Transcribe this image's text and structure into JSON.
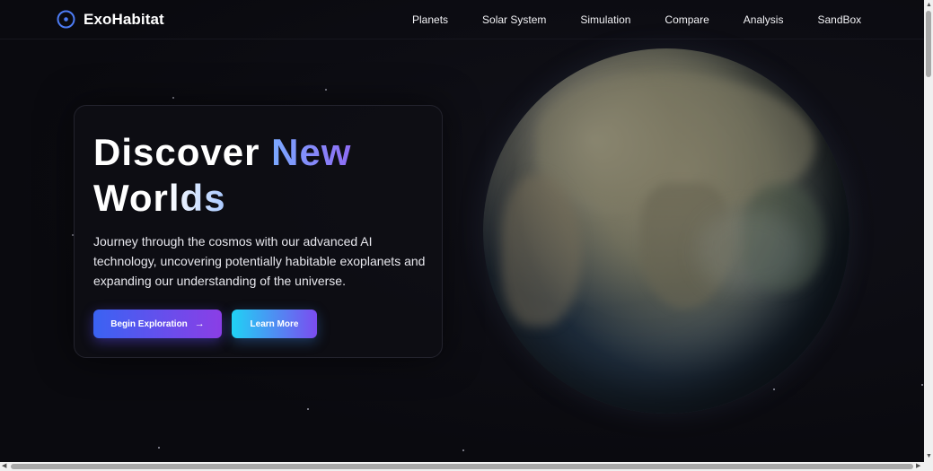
{
  "header": {
    "brand": "ExoHabitat",
    "nav": [
      "Planets",
      "Solar System",
      "Simulation",
      "Compare",
      "Analysis",
      "SandBox"
    ]
  },
  "hero": {
    "title_part1": "Discover",
    "title_part2": "New",
    "title_part3": "Worlds",
    "description": "Journey through the cosmos with our advanced AI technology, uncovering potentially habitable exoplanets and expanding our understanding of the universe.",
    "primary_button": "Begin Exploration",
    "primary_button_icon": "arrow-right-icon",
    "secondary_button": "Learn More"
  },
  "colors": {
    "background": "#0b0b10",
    "accent_blue": "#3a63f3",
    "accent_purple": "#8b3ee6",
    "accent_cyan": "#20d2f5"
  }
}
